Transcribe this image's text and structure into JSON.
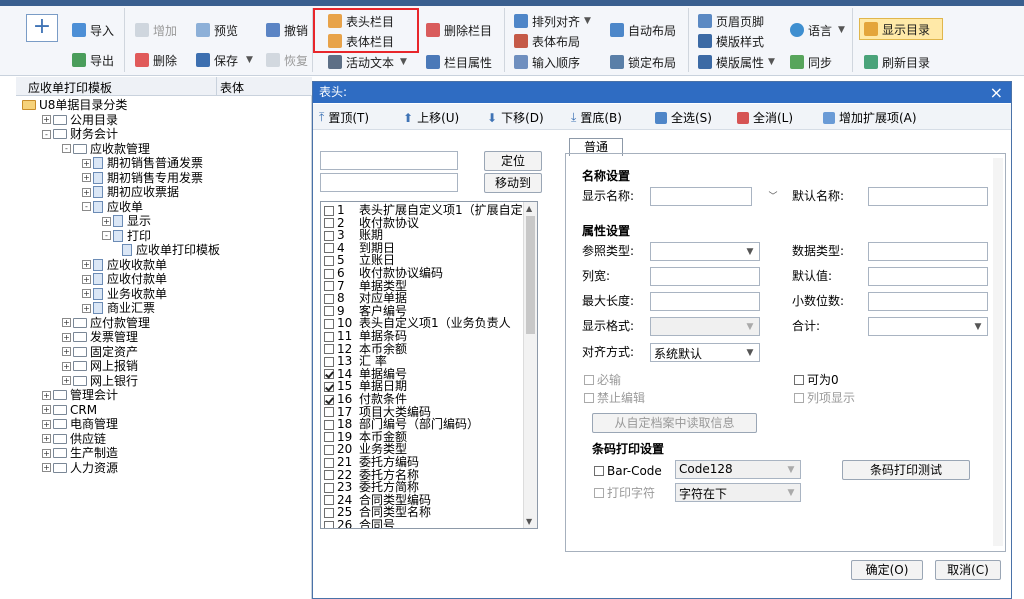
{
  "toolbar": {
    "import": "导入",
    "export": "导出",
    "add": "增加",
    "delete": "删除",
    "preview": "预览",
    "save": "保存",
    "undo": "撤销",
    "restore": "恢复",
    "header_column": "表头栏目",
    "body_column": "表体栏目",
    "active_text": "活动文本",
    "delete_column": "删除栏目",
    "column_props": "栏目属性",
    "arrange_align": "排列对齐",
    "body_layout": "表体布局",
    "input_order": "输入顺序",
    "auto_layout": "自动布局",
    "lock_layout": "锁定布局",
    "header_footer": "页眉页脚",
    "template_style": "模版样式",
    "template_props": "模版属性",
    "language": "语言",
    "sync": "同步",
    "show_dir": "显示目录",
    "refresh_dir": "刷新目录"
  },
  "left": {
    "col1": "应收单打印模板",
    "col2": "表体",
    "tree": [
      {
        "label": "U8单据目录分类",
        "level": 0,
        "pm": ""
      },
      {
        "label": "公用目录",
        "level": 1,
        "pm": "+"
      },
      {
        "label": "财务会计",
        "level": 1,
        "pm": "-"
      },
      {
        "label": "应收款管理",
        "level": 2,
        "pm": "-"
      },
      {
        "label": "期初销售普通发票",
        "level": 3,
        "pm": "+"
      },
      {
        "label": "期初销售专用发票",
        "level": 3,
        "pm": "+"
      },
      {
        "label": "期初应收票据",
        "level": 3,
        "pm": "+"
      },
      {
        "label": "应收单",
        "level": 3,
        "pm": "-"
      },
      {
        "label": "显示",
        "level": 4,
        "pm": "+"
      },
      {
        "label": "打印",
        "level": 4,
        "pm": "-"
      },
      {
        "label": "应收单打印模板",
        "level": 5,
        "pm": ""
      },
      {
        "label": "应收收款单",
        "level": 3,
        "pm": "+"
      },
      {
        "label": "应收付款单",
        "level": 3,
        "pm": "+"
      },
      {
        "label": "业务收款单",
        "level": 3,
        "pm": "+"
      },
      {
        "label": "商业汇票",
        "level": 3,
        "pm": "+"
      },
      {
        "label": "应付款管理",
        "level": 2,
        "pm": "+"
      },
      {
        "label": "发票管理",
        "level": 2,
        "pm": "+"
      },
      {
        "label": "固定资产",
        "level": 2,
        "pm": "+"
      },
      {
        "label": "网上报销",
        "level": 2,
        "pm": "+"
      },
      {
        "label": "网上银行",
        "level": 2,
        "pm": "+"
      },
      {
        "label": "管理会计",
        "level": 1,
        "pm": "+"
      },
      {
        "label": "CRM",
        "level": 1,
        "pm": "+"
      },
      {
        "label": "电商管理",
        "level": 1,
        "pm": "+"
      },
      {
        "label": "供应链",
        "level": 1,
        "pm": "+"
      },
      {
        "label": "生产制造",
        "level": 1,
        "pm": "+"
      },
      {
        "label": "人力资源",
        "level": 1,
        "pm": "+"
      }
    ]
  },
  "dialog": {
    "title": "表头:",
    "close": "×",
    "bar": {
      "top": "置顶(T)",
      "up": "上移(U)",
      "down": "下移(D)",
      "bottom": "置底(B)",
      "select_all": "全选(S)",
      "clear_all": "全消(L)",
      "add_ext": "增加扩展项(A)"
    },
    "locate": "定位",
    "move_to": "移动到",
    "items": [
      {
        "no": "1",
        "text": "表头扩展自定义项1（扩展自定",
        "checked": false
      },
      {
        "no": "2",
        "text": "收付款协议",
        "checked": false
      },
      {
        "no": "3",
        "text": "账期",
        "checked": false
      },
      {
        "no": "4",
        "text": "到期日",
        "checked": false
      },
      {
        "no": "5",
        "text": "立账日",
        "checked": false
      },
      {
        "no": "6",
        "text": "收付款协议编码",
        "checked": false
      },
      {
        "no": "7",
        "text": "单据类型",
        "checked": false
      },
      {
        "no": "8",
        "text": "对应单据",
        "checked": false
      },
      {
        "no": "9",
        "text": "客户编号",
        "checked": false
      },
      {
        "no": "10",
        "text": "表头自定义项1（业务负责人",
        "checked": false
      },
      {
        "no": "11",
        "text": "单据条码",
        "checked": false
      },
      {
        "no": "12",
        "text": "本币余额",
        "checked": false
      },
      {
        "no": "13",
        "text": "汇    率",
        "checked": false
      },
      {
        "no": "14",
        "text": "单据编号",
        "checked": true
      },
      {
        "no": "15",
        "text": "单据日期",
        "checked": true
      },
      {
        "no": "16",
        "text": "付款条件",
        "checked": true
      },
      {
        "no": "17",
        "text": "项目大类编码",
        "checked": false
      },
      {
        "no": "18",
        "text": "部门编号（部门编码）",
        "checked": false
      },
      {
        "no": "19",
        "text": "本币金额",
        "checked": false
      },
      {
        "no": "20",
        "text": "业务类型",
        "checked": false
      },
      {
        "no": "21",
        "text": "委托方编码",
        "checked": false
      },
      {
        "no": "22",
        "text": "委托方名称",
        "checked": false
      },
      {
        "no": "23",
        "text": "委托方简称",
        "checked": false
      },
      {
        "no": "24",
        "text": "合同类型编码",
        "checked": false
      },
      {
        "no": "25",
        "text": "合同类型名称",
        "checked": false
      },
      {
        "no": "26",
        "text": "合同号",
        "checked": false
      }
    ],
    "tab": "普通",
    "name_settings": "名称设置",
    "display_name": "显示名称:",
    "default_name": "默认名称:",
    "attr_settings": "属性设置",
    "ref_type": "参照类型:",
    "data_type": "数据类型:",
    "col_width": "列宽:",
    "default_val": "默认值:",
    "max_len": "最大长度:",
    "decimals": "小数位数:",
    "display_fmt": "显示格式:",
    "total": "合计:",
    "align": "对齐方式:",
    "align_value": "系统默认",
    "required": "必输",
    "nullable": "可为0",
    "no_edit": "禁止编辑",
    "col_display": "列项显示",
    "read_custom": "从自定档案中读取信息",
    "barcode_settings": "条码打印设置",
    "barcode": "Bar-Code",
    "barcode_value": "Code128",
    "print_chars": "打印字符",
    "chars_value": "字符在下",
    "barcode_test": "条码打印测试",
    "ok": "确定(O)",
    "cancel": "取消(C)"
  },
  "colors": {
    "title_bar": "#2f6cc2",
    "highlight": "#e8262b",
    "accent": "#3f73b5"
  }
}
